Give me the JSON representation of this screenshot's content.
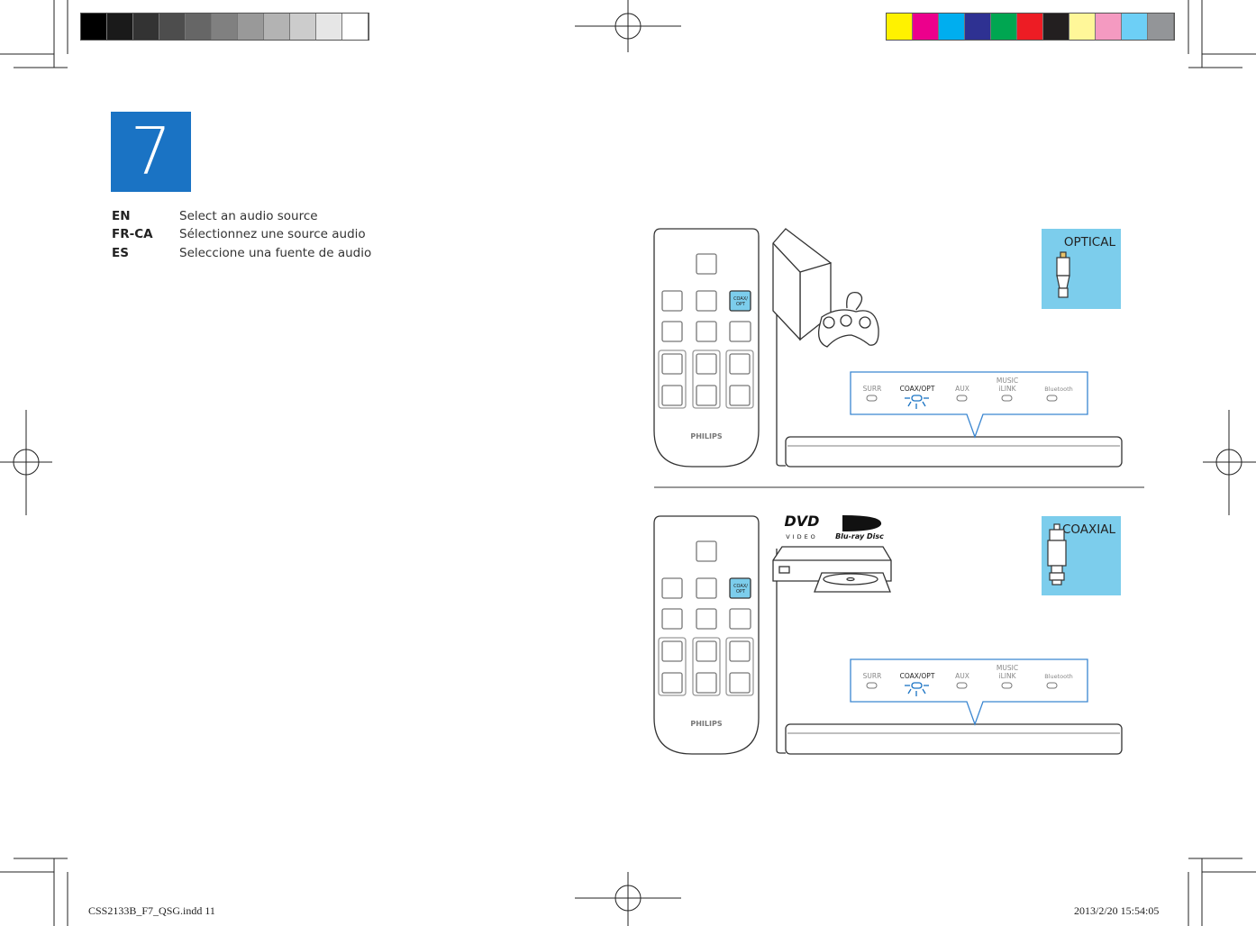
{
  "color_bars": {
    "grayscale": [
      "#000000",
      "#1a1a1a",
      "#333333",
      "#4d4d4d",
      "#666666",
      "#808080",
      "#999999",
      "#b3b3b3",
      "#cccccc",
      "#e6e6e6",
      "#ffffff"
    ],
    "process": [
      "#fff200",
      "#ec008c",
      "#00aeef",
      "#2e3192",
      "#00a651",
      "#ed1c24",
      "#231f20",
      "#fff799",
      "#f49ac1",
      "#6dcff6",
      "#939598"
    ]
  },
  "step": {
    "number": "7",
    "color": "#1a73c4"
  },
  "instructions": [
    {
      "lang": "EN",
      "text": "Select an audio source"
    },
    {
      "lang": "FR-CA",
      "text": "Sélectionnez une source audio"
    },
    {
      "lang": "ES",
      "text": "Seleccione una fuente de audio"
    }
  ],
  "diagram": {
    "remote": {
      "brand": "PHILIPS",
      "highlight_button": "COAX/\nOPT",
      "btn_line1": "COAX/",
      "btn_line2": "OPT"
    },
    "display": {
      "surr": "SURR",
      "coax_opt": "COAX/OPT",
      "aux": "AUX",
      "music1": "MUSIC",
      "music2": "iLINK",
      "bluetooth": "Bluetooth"
    },
    "optical_label": "OPTICAL",
    "coaxial_label": "COAXIAL",
    "dvd_logo": "DVD",
    "dvd_sub": "VIDEO",
    "bluray_logo": "Blu-ray Disc",
    "accent_color": "#7ccdec"
  },
  "footer": {
    "file": "CSS2133B_F7_QSG.indd   11",
    "timestamp": "2013/2/20   15:54:05"
  }
}
